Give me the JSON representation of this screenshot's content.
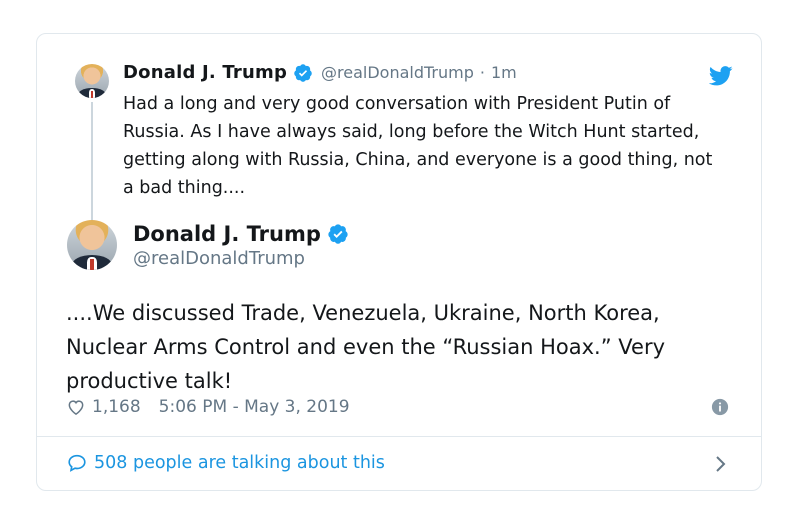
{
  "quoted_tweet": {
    "name": "Donald J. Trump",
    "handle": "@realDonaldTrump",
    "separator": "·",
    "time": "1m",
    "text": "Had a long and very good conversation with President Putin of Russia. As I have always said, long before the Witch Hunt started, getting along with Russia, China, and everyone is a good thing, not a bad thing....",
    "avatar_icon": "profile-photo",
    "platform_icon": "twitter-bird-icon"
  },
  "main_tweet": {
    "name": "Donald J. Trump",
    "handle": "@realDonaldTrump",
    "text": "....We discussed Trade, Venezuela, Ukraine, North Korea, Nuclear Arms Control and even the “Russian Hoax.” Very productive talk!",
    "likes": "1,168",
    "timestamp": "5:06 PM - May 3, 2019"
  },
  "footer": {
    "talking_text": "508 people are talking about this"
  },
  "colors": {
    "accent": "#1da1f2",
    "link": "#1b95e0",
    "muted": "#657786",
    "border": "#e1e8ed"
  }
}
